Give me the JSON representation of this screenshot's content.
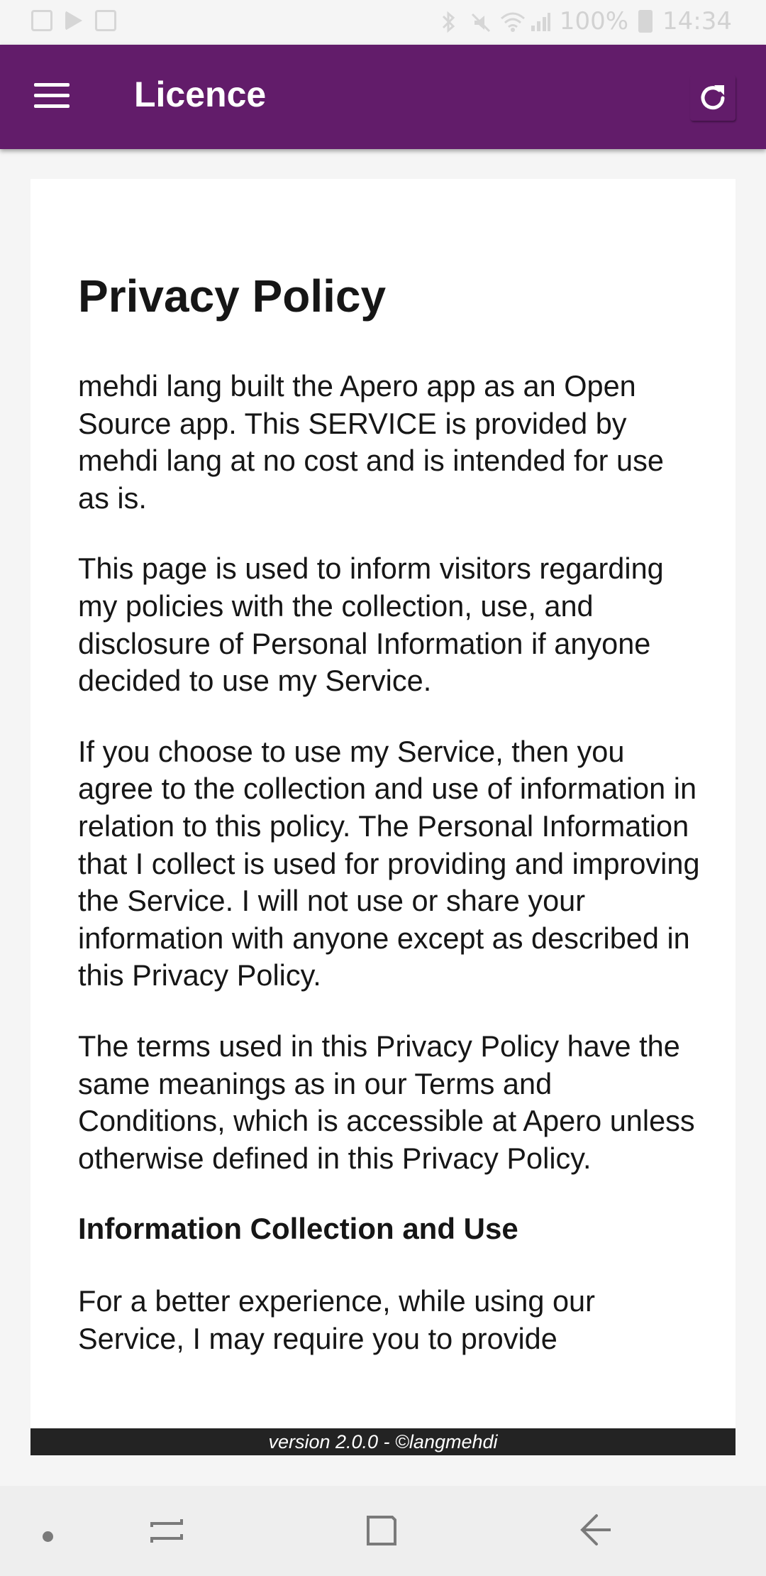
{
  "status_bar": {
    "battery": "100%",
    "time": "14:34"
  },
  "app_bar": {
    "title": "Licence",
    "menu_icon": "hamburger-menu-icon",
    "refresh_icon": "refresh-icon"
  },
  "document": {
    "title": "Privacy Policy",
    "paragraphs": [
      "mehdi lang built the Apero app as an Open Source app. This SERVICE is provided by mehdi lang at no cost and is intended for use as is.",
      "This page is used to inform visitors regarding my policies with the collection, use, and disclosure of Personal Information if anyone decided to use my Service.",
      "If you choose to use my Service, then you agree to the collection and use of information in relation to this policy. The Personal Information that I collect is used for providing and improving the Service. I will not use or share your information with anyone except as described in this Privacy Policy.",
      "The terms used in this Privacy Policy have the same meanings as in our Terms and Conditions, which is accessible at Apero unless otherwise defined in this Privacy Policy."
    ],
    "section_heading": "Information Collection and Use",
    "section_paragraph": "For a better experience, while using our Service, I may require you to provide"
  },
  "footer": {
    "version": "version 2.0.0 - ©langmehdi"
  },
  "colors": {
    "app_bar": "#621c6a",
    "card": "#ffffff",
    "background": "#f5f5f5",
    "version_bar": "#232323"
  }
}
